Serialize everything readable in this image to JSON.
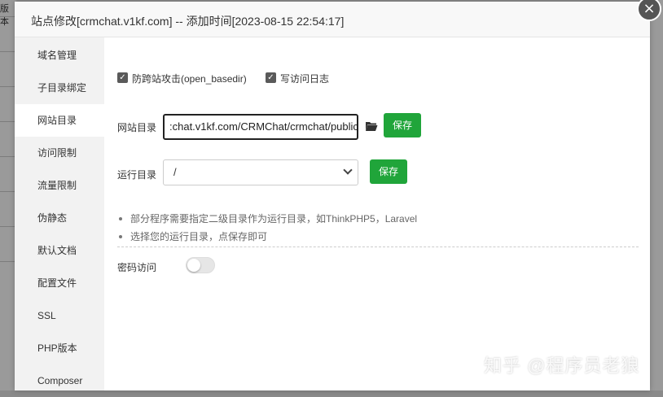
{
  "backdrop": {
    "cut_text": "版本"
  },
  "dialog": {
    "title": "站点修改[crmchat.v1kf.com] -- 添加时间[2023-08-15 22:54:17]",
    "close_glyph": "×"
  },
  "sidebar": {
    "items": [
      {
        "label": "域名管理"
      },
      {
        "label": "子目录绑定"
      },
      {
        "label": "网站目录"
      },
      {
        "label": "访问限制"
      },
      {
        "label": "流量限制"
      },
      {
        "label": "伪静态"
      },
      {
        "label": "默认文档"
      },
      {
        "label": "配置文件"
      },
      {
        "label": "SSL"
      },
      {
        "label": "PHP版本"
      },
      {
        "label": "Composer"
      }
    ],
    "active_index": 2
  },
  "content": {
    "checkboxes": [
      {
        "label": "防跨站攻击(open_basedir)",
        "checked": true
      },
      {
        "label": "写访问日志",
        "checked": true
      }
    ],
    "site_dir": {
      "label": "网站目录",
      "value": ":chat.v1kf.com/CRMChat/crmchat/public",
      "save_label": "保存"
    },
    "run_dir": {
      "label": "运行目录",
      "value": "/",
      "save_label": "保存"
    },
    "tips": [
      "部分程序需要指定二级目录作为运行目录，如ThinkPHP5，Laravel",
      "选择您的运行目录，点保存即可"
    ],
    "password_access": {
      "label": "密码访问",
      "enabled": false
    }
  },
  "watermark": {
    "text": "知乎 @程序员老狼"
  },
  "colors": {
    "accent": "#20a53a",
    "sidebar_bg": "#f2f2f2",
    "header_bg": "#f8f8f8"
  }
}
